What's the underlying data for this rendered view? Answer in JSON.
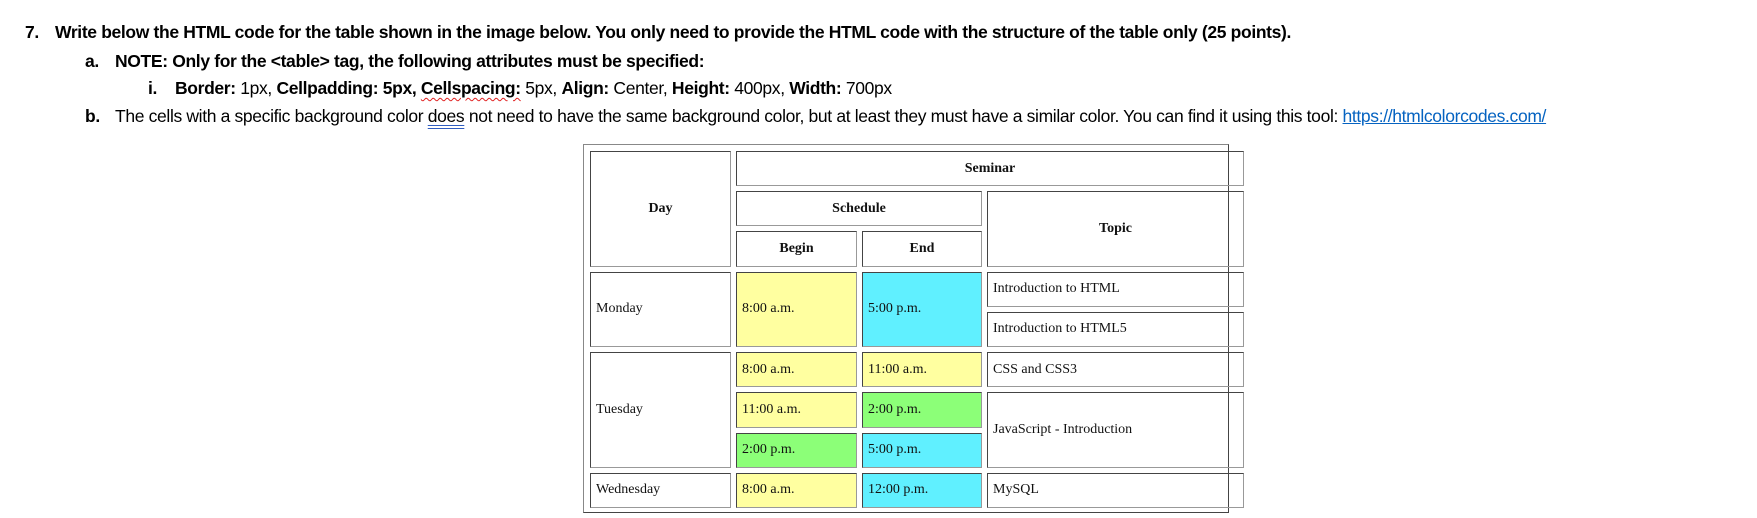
{
  "instructions": {
    "q7": {
      "marker": "7.",
      "text": "Write below the HTML code for the table shown in the image below. You only need to provide the HTML code with the structure of the table only (25 points)."
    },
    "a": {
      "marker": "a.",
      "text": "NOTE: Only for the <table> tag, the following attributes must be specified:"
    },
    "i": {
      "marker": "i.",
      "border_label": "Border:",
      "border_value": " 1px, ",
      "cellpadding_label": "Cellpadding: 5px, ",
      "cellspacing_label": "Cellspacing:",
      "cellspacing_value": " 5px, ",
      "align_label": "Align:",
      "align_value": " Center, ",
      "height_label": "Height:",
      "height_value": " 400px, ",
      "width_label": "Width:",
      "width_value": " 700px"
    },
    "b": {
      "marker": "b.",
      "text_before": "The cells with a specific background color ",
      "text_underlined": "does",
      "text_after": " not need to have the same background color, but at least they must have a similar color. You can find it using this tool: ",
      "link": "https://htmlcolorcodes.com/"
    }
  },
  "table": {
    "colors": {
      "yellow": "#FFFFA0",
      "cyan": "#60F0FF",
      "green": "#8CFF78"
    },
    "headers": {
      "day": "Day",
      "seminar": "Seminar",
      "schedule": "Schedule",
      "topic": "Topic",
      "begin": "Begin",
      "end": "End"
    },
    "rows": {
      "monday": {
        "day": "Monday",
        "begin": "8:00 a.m.",
        "end": "5:00 p.m.",
        "topics": [
          "Introduction to HTML",
          "Introduction to HTML5"
        ]
      },
      "tuesday": {
        "day": "Tuesday",
        "slots": [
          {
            "begin": "8:00 a.m.",
            "end": "11:00 a.m.",
            "topic": "CSS and CSS3"
          },
          {
            "begin": "11:00 a.m.",
            "end": "2:00 p.m.",
            "topic": "JavaScript - Introduction"
          },
          {
            "begin": "2:00 p.m.",
            "end": "5:00 p.m."
          }
        ]
      },
      "wednesday": {
        "day": "Wednesday",
        "begin": "8:00 a.m.",
        "end": "12:00 p.m.",
        "topic": "MySQL"
      }
    }
  }
}
